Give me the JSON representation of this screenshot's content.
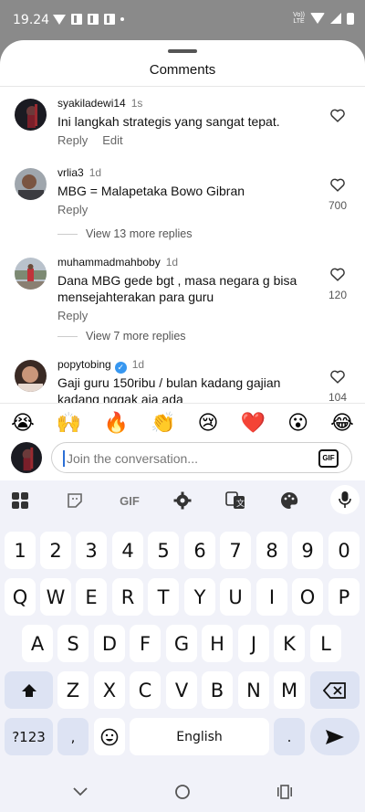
{
  "status_bar": {
    "time": "19.24",
    "net_label_top": "Vo))",
    "net_label_bottom": "LTE"
  },
  "sheet": {
    "title": "Comments"
  },
  "comments": [
    {
      "username": "syakiladewi14",
      "time": "1s",
      "text": "Ini langkah strategis yang sangat tepat.",
      "actions": [
        "Reply",
        "Edit"
      ],
      "likes": ""
    },
    {
      "username": "vrlia3",
      "time": "1d",
      "text": "MBG = Malapetaka Bowo Gibran",
      "actions": [
        "Reply"
      ],
      "likes": "700",
      "view_more": "View 13 more replies"
    },
    {
      "username": "muhammadmahboby",
      "time": "1d",
      "text": "Dana MBG gede bgt , masa negara g bisa mensejahterakan para guru",
      "actions": [
        "Reply"
      ],
      "likes": "120",
      "view_more": "View 7 more replies"
    },
    {
      "username": "popytobing",
      "time": "1d",
      "text": "Gaji guru 150ribu / bulan kadang gajian kadang nggak aja ada",
      "actions": [],
      "likes": "104",
      "verified": true
    }
  ],
  "emoji_bar": [
    "😭",
    "🙌",
    "🔥",
    "👏",
    "😢",
    "❤️",
    "😮",
    "😂"
  ],
  "compose": {
    "placeholder": "Join the conversation...",
    "gif_label": "GIF"
  },
  "keyboard": {
    "toolbar": {
      "gif_label": "GIF"
    },
    "row_numbers": [
      "1",
      "2",
      "3",
      "4",
      "5",
      "6",
      "7",
      "8",
      "9",
      "0"
    ],
    "row_1": [
      "Q",
      "W",
      "E",
      "R",
      "T",
      "Y",
      "U",
      "I",
      "O",
      "P"
    ],
    "row_2": [
      "A",
      "S",
      "D",
      "F",
      "G",
      "H",
      "J",
      "K",
      "L"
    ],
    "row_3": [
      "Z",
      "X",
      "C",
      "V",
      "B",
      "N",
      "M"
    ],
    "bottom": {
      "symbols": "?123",
      "comma": ",",
      "space": "English",
      "period": "."
    }
  },
  "colors": {
    "accent": "#2c6fd6",
    "verified": "#3797f0",
    "keyboard_bg": "#f1f2f9",
    "special_key": "#dde3f3"
  }
}
